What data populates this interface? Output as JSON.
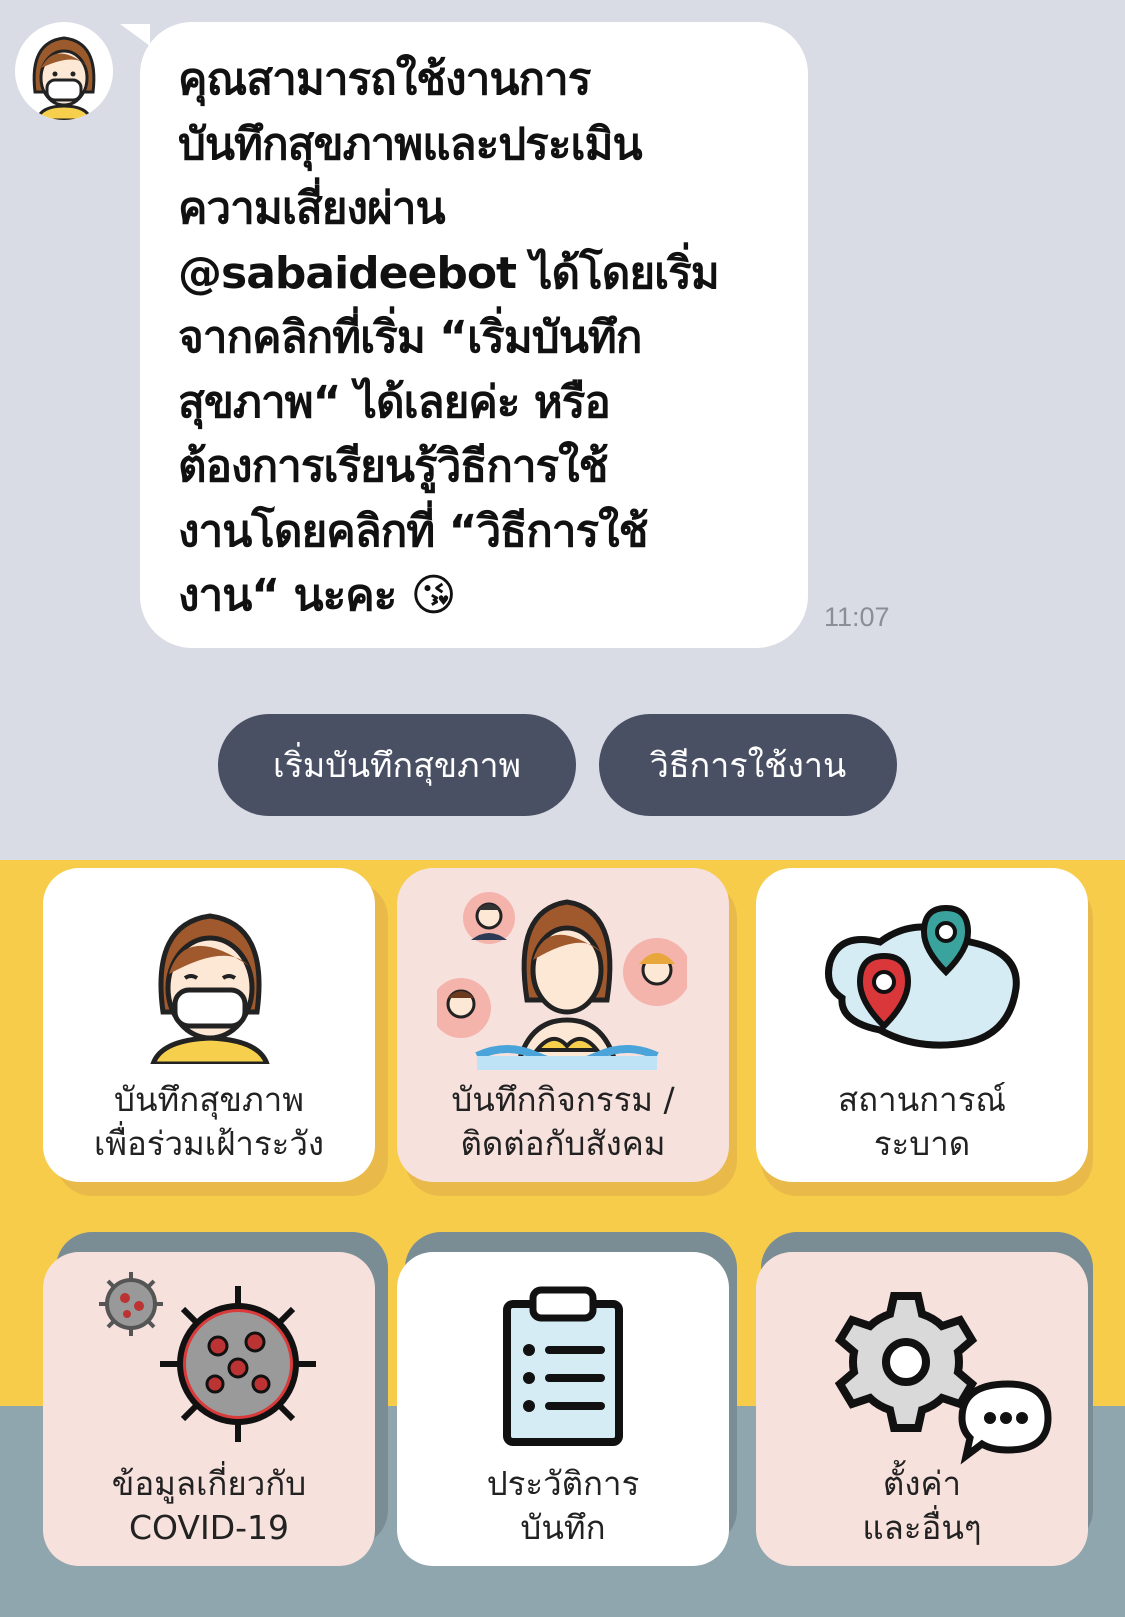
{
  "chat": {
    "bubble_text": "คุณสามารถใช้งานการ\nบันทึกสุขภาพและประเมิน\nความเสี่ยงผ่าน\n@sabaideebot ได้โดยเริ่ม\nจากคลิกที่เริ่ม “เริ่มบันทึก\nสุขภาพ“ ได้เลยค่ะ หรือ\nต้องการเรียนรู้วิธีการใช้\nงานโดยคลิกที่ “วิธีการใช้\nงาน“ นะคะ 😘",
    "time": "11:07"
  },
  "quick_replies": [
    {
      "label": "เริ่มบันทึกสุขภาพ"
    },
    {
      "label": "วิธีการใช้งาน"
    }
  ],
  "menu": {
    "tiles": [
      {
        "line1": "บันทึกสุขภาพ",
        "line2": "เพื่อร่วมเฝ้าระวัง",
        "icon": "masked-woman-icon"
      },
      {
        "line1": "บันทึกกิจกรรม /",
        "line2": "ติดต่อกับสังคม",
        "icon": "social-contacts-icon"
      },
      {
        "line1": "สถานการณ์",
        "line2": "ระบาด",
        "icon": "map-pins-icon"
      },
      {
        "line1": "ข้อมูลเกี่ยวกับ",
        "line2": "COVID-19",
        "icon": "virus-icon"
      },
      {
        "line1": "ประวัติการ",
        "line2": "บันทึก",
        "icon": "clipboard-icon"
      },
      {
        "line1": "ตั้งค่า",
        "line2": "และอื่นๆ",
        "icon": "gear-chat-icon"
      }
    ]
  },
  "colors": {
    "chat_bg": "#d9dce5",
    "button_bg": "#4a5064",
    "menu_yellow": "#f6cc4a",
    "menu_slate": "#8fa6ae",
    "tile_pink": "#f7e1dd"
  }
}
